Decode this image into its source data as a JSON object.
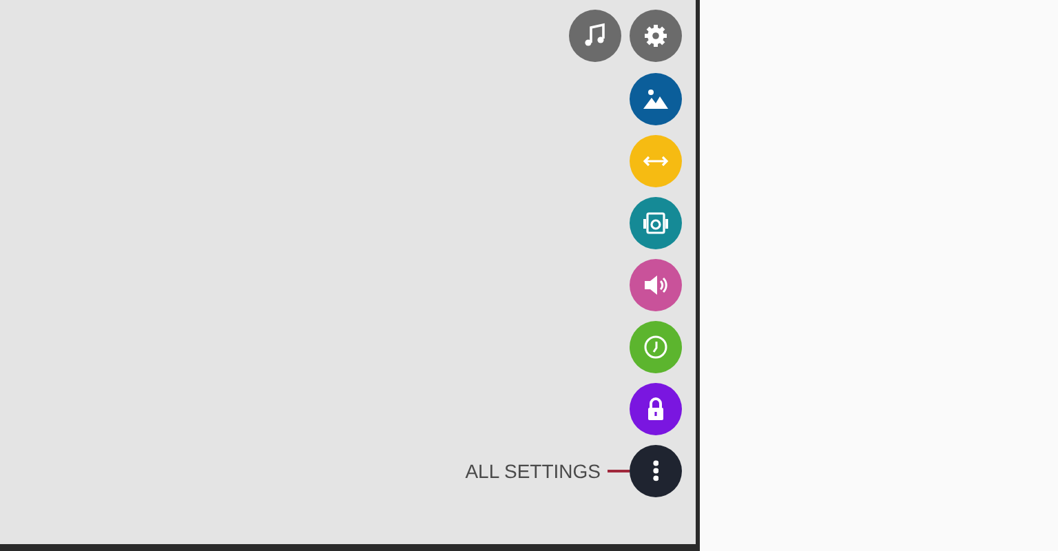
{
  "top_buttons": [
    {
      "kind": "music",
      "color": "#6b6b6b"
    },
    {
      "kind": "settings",
      "color": "#6b6b6b"
    }
  ],
  "menu": [
    {
      "kind": "picture",
      "color": "#0b5e9a"
    },
    {
      "kind": "aspect",
      "color": "#f6bb12"
    },
    {
      "kind": "speaker",
      "color": "#158a96"
    },
    {
      "kind": "sound",
      "color": "#c9529a"
    },
    {
      "kind": "clock",
      "color": "#5cb52e"
    },
    {
      "kind": "lock",
      "color": "#7a16e0"
    },
    {
      "kind": "more",
      "color": "#1f2430",
      "label": "ALL SETTINGS"
    }
  ]
}
